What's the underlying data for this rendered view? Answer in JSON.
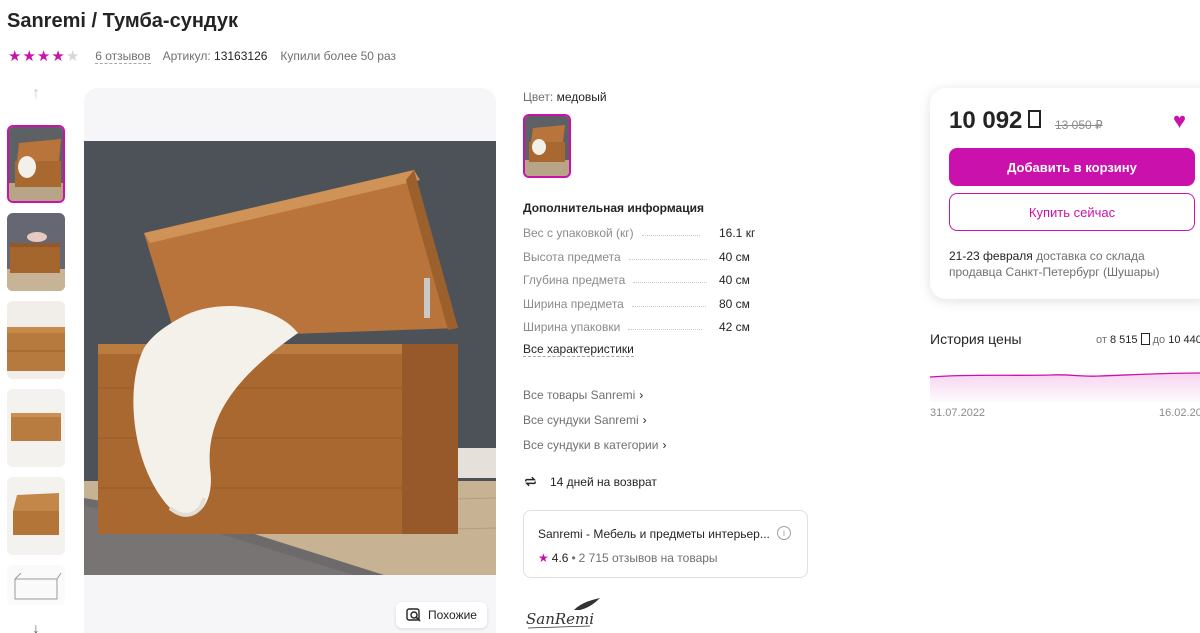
{
  "product": {
    "title": "Sanremi / Тумба-сундук",
    "rating_stars": 4,
    "reviews_label": "6 отзывов",
    "article_label": "Артикул:",
    "article_value": "13163126",
    "bought_label": "Купили более 50 раз"
  },
  "gallery": {
    "similar_label": "Похожие"
  },
  "color": {
    "label": "Цвет:",
    "value": "медовый"
  },
  "specs": {
    "title": "Дополнительная информация",
    "rows": [
      {
        "key": "Вес с упаковкой (кг)",
        "value": "16.1 кг"
      },
      {
        "key": "Высота предмета",
        "value": "40 см"
      },
      {
        "key": "Глубина предмета",
        "value": "40 см"
      },
      {
        "key": "Ширина предмета",
        "value": "80 см"
      },
      {
        "key": "Ширина упаковки",
        "value": "42 см"
      }
    ],
    "all_label": "Все характеристики"
  },
  "links": [
    "Все товары Sanremi",
    "Все сундуки Sanremi",
    "Все сундуки в категории"
  ],
  "returns": {
    "label": "14 дней на возврат"
  },
  "seller": {
    "name": "Sanremi - Мебель и предметы интерьер...",
    "rating": "4.6",
    "reviews": "2 715 отзывов на товары",
    "logo_text": "SanRemi"
  },
  "price_card": {
    "price": "10 092",
    "old_price": "13 050 ₽",
    "add_to_cart": "Добавить в корзину",
    "buy_now": "Купить сейчас",
    "delivery_dates": "21-23 февраля",
    "delivery_text": "доставка со склада продавца Санкт-Петербург (Шушары)"
  },
  "price_history": {
    "title": "История цены",
    "range_from_label": "от",
    "range_min": "8 515",
    "range_to_label": "до",
    "range_max": "10 440",
    "date_start": "31.07.2022",
    "date_end": "16.02.20"
  },
  "colors": {
    "accent": "#cb11ab",
    "text": "#242424",
    "muted": "#707070"
  }
}
